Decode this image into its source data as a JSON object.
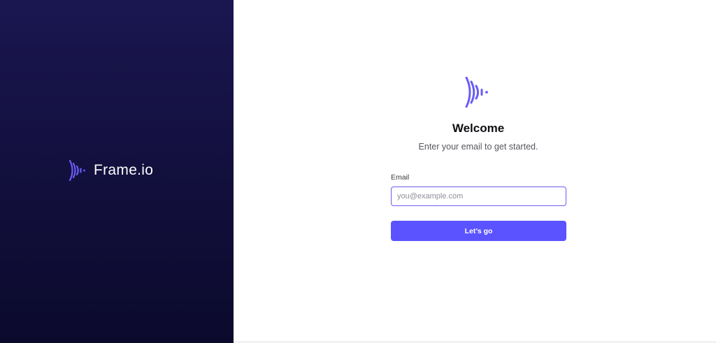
{
  "brand": {
    "name": "Frame.io",
    "logo_icon": "frameio-wave-icon",
    "panel_color_top": "#1a1650",
    "panel_color_bottom": "#0b0a2c",
    "accent": "#6a5cf6"
  },
  "form": {
    "logo_icon": "frameio-wave-icon",
    "title": "Welcome",
    "subtitle": "Enter your email to get started.",
    "email_label": "Email",
    "email_value": "",
    "email_placeholder": "you@example.com",
    "submit_label": "Let’s go",
    "button_color": "#5b53ff"
  }
}
